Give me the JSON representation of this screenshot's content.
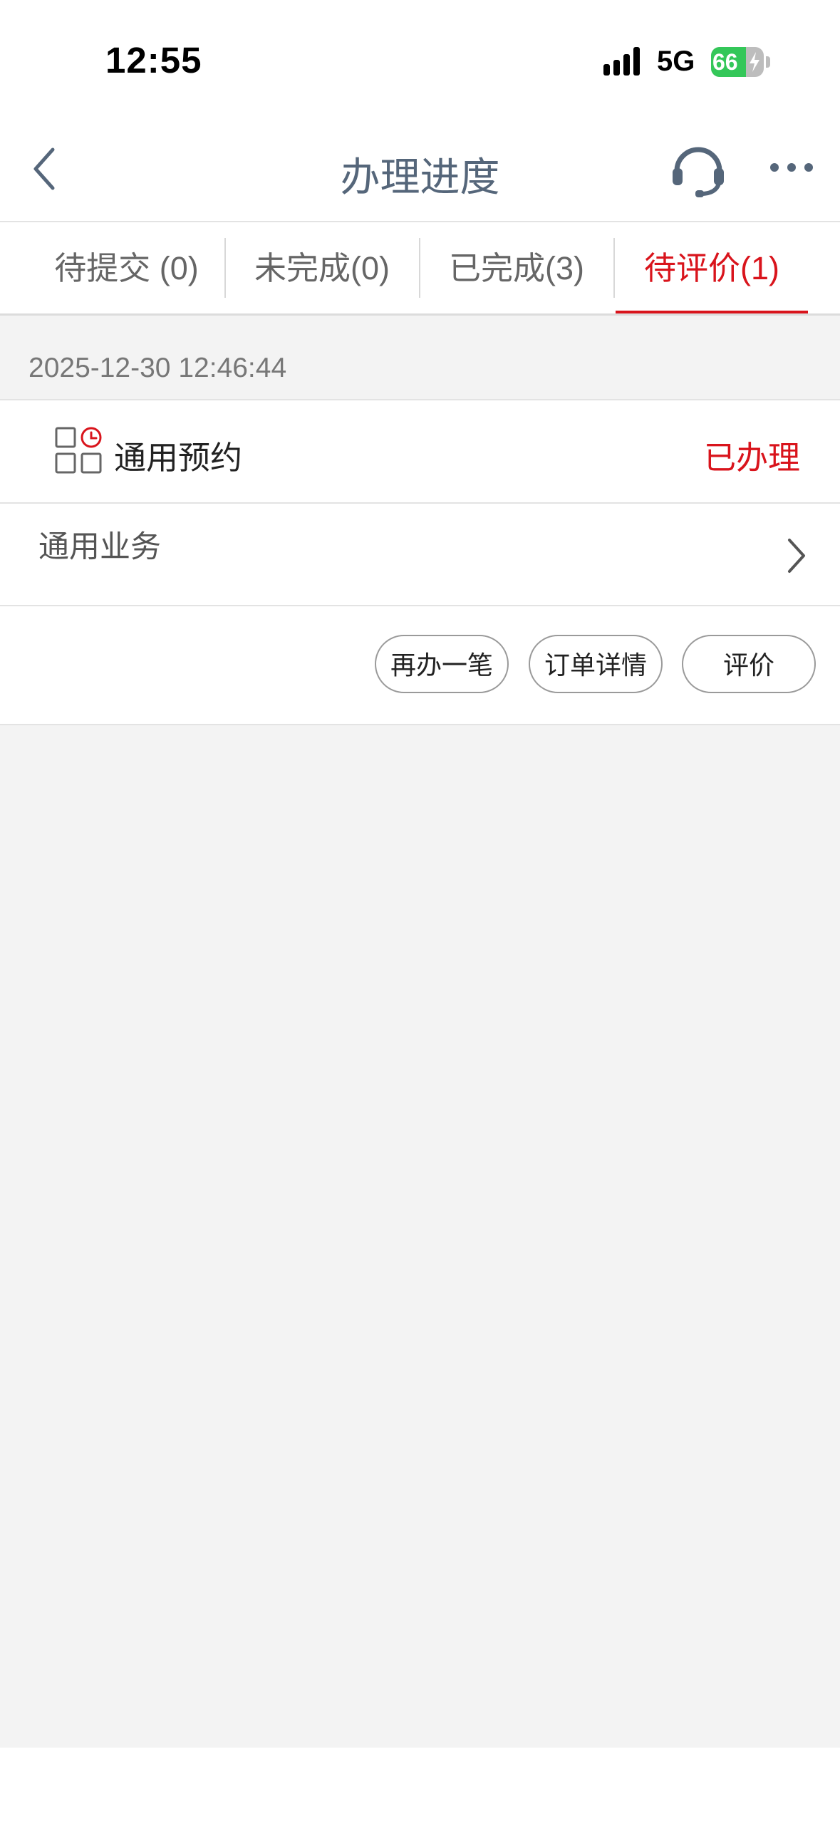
{
  "status_bar": {
    "time": "12:55",
    "network": "5G",
    "battery_percent": "66",
    "battery_level": 0.66,
    "charging": true
  },
  "nav": {
    "title": "办理进度",
    "back_icon": "chevron-left-icon",
    "support_icon": "headset-icon",
    "more_icon": "more-dots-icon"
  },
  "tabs": [
    {
      "label": "待提交 (0)"
    },
    {
      "label": "未完成(0)"
    },
    {
      "label": "已完成(3)"
    },
    {
      "label": "待评价(1)"
    }
  ],
  "active_tab": "待评价(1)",
  "record": {
    "timestamp": "2025-12-30 12:46:44",
    "service_name": "通用预约",
    "service_icon": "appointment-grid-icon",
    "status": "已办理",
    "business": "通用业务",
    "actions": {
      "again": "再办一笔",
      "details": "订单详情",
      "rate": "评价"
    }
  },
  "colors": {
    "accent": "#d9141c",
    "title": "#55667a",
    "background": "#f3f3f3",
    "battery": "#34c759"
  }
}
